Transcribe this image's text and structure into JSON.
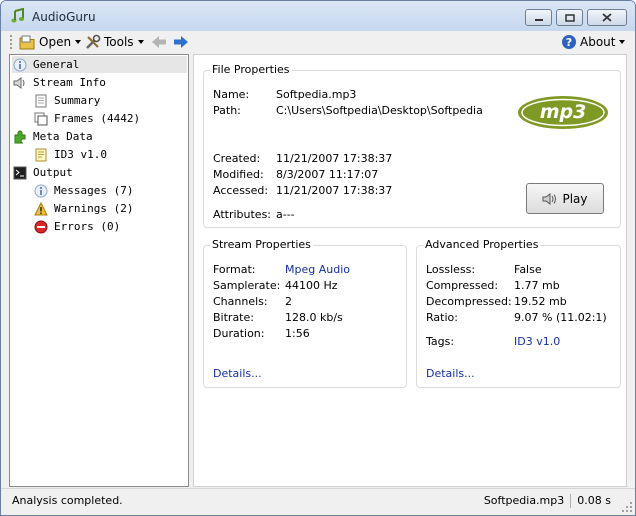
{
  "window": {
    "title": "AudioGuru"
  },
  "toolbar": {
    "open_label": "Open",
    "tools_label": "Tools",
    "about_label": "About"
  },
  "tree": {
    "general": "General",
    "stream_info": "Stream Info",
    "summary": "Summary",
    "frames": "Frames (4442)",
    "meta_data": "Meta Data",
    "id3": "ID3 v1.0",
    "output": "Output",
    "messages": "Messages (7)",
    "warnings": "Warnings (2)",
    "errors": "Errors (0)"
  },
  "file_properties": {
    "title": "File Properties",
    "name_label": "Name:",
    "name_value": "Softpedia.mp3",
    "path_label": "Path:",
    "path_value": "C:\\Users\\Softpedia\\Desktop\\Softpedia",
    "created_label": "Created:",
    "created_value": "11/21/2007 17:38:37",
    "modified_label": "Modified:",
    "modified_value": "8/3/2007 11:17:07",
    "accessed_label": "Accessed:",
    "accessed_value": "11/21/2007 17:38:37",
    "attributes_label": "Attributes:",
    "attributes_value": "a---",
    "logo_text": "mp3",
    "play_label": "Play"
  },
  "stream_properties": {
    "title": "Stream Properties",
    "format_label": "Format:",
    "format_value": "Mpeg Audio",
    "samplerate_label": "Samplerate:",
    "samplerate_value": "44100 Hz",
    "channels_label": "Channels:",
    "channels_value": "2",
    "bitrate_label": "Bitrate:",
    "bitrate_value": "128.0 kb/s",
    "duration_label": "Duration:",
    "duration_value": "1:56",
    "details_link": "Details..."
  },
  "advanced_properties": {
    "title": "Advanced Properties",
    "lossless_label": "Lossless:",
    "lossless_value": "False",
    "compressed_label": "Compressed:",
    "compressed_value": "1.77 mb",
    "decompressed_label": "Decompressed:",
    "decompressed_value": "19.52 mb",
    "ratio_label": "Ratio:",
    "ratio_value": "9.07 % (11.02:1)",
    "tags_label": "Tags:",
    "tags_value": "ID3 v1.0",
    "details_link": "Details..."
  },
  "status": {
    "message": "Analysis completed.",
    "file": "Softpedia.mp3",
    "time": "0.08 s"
  },
  "colors": {
    "link": "#1530a8",
    "mp3_logo": "#7f9a24"
  }
}
